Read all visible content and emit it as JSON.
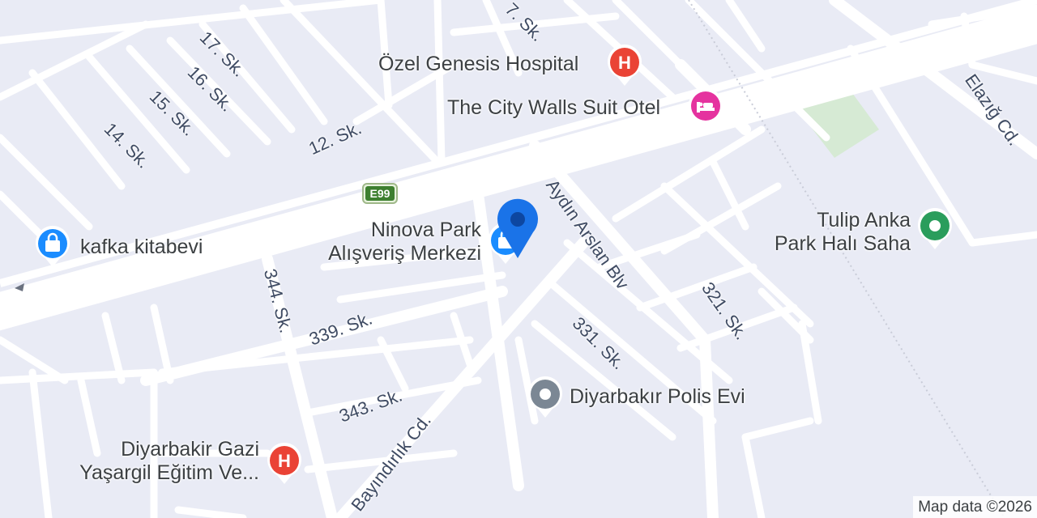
{
  "map": {
    "colors": {
      "background": "#e9ebf5",
      "road": "#ffffff",
      "park": "#d6ead4",
      "hospital": "#ea4335",
      "hotel": "#e5339f",
      "shopping": "#1a8cff",
      "park_poi": "#2a9d5c",
      "generic_poi": "#7b8794",
      "location_marker": "#1a73e8"
    },
    "streets": {
      "s17": "17. Sk.",
      "s16": "16. Sk.",
      "s15": "15. Sk.",
      "s14": "14. Sk.",
      "s12": "12. Sk.",
      "s7": "7. Sk.",
      "elazig": "Elazığ Cd.",
      "aydin": "Aydın Arslan Blv",
      "s321": "321. Sk.",
      "s331": "331. Sk.",
      "s339": "339. Sk.",
      "s344": "344. Sk.",
      "s343": "343. Sk.",
      "bayindirlik": "Bayındırlık Cd."
    },
    "route_shield": "E99",
    "pois": {
      "genesis": {
        "name": "Özel Genesis Hospital",
        "icon": "hospital-icon"
      },
      "city_walls": {
        "name": "The City Walls Suit Otel",
        "icon": "hotel-icon"
      },
      "ninova": {
        "name_line1": "Ninova Park",
        "name_line2": "Alışveriş Merkezi",
        "icon": "shopping-bag-icon"
      },
      "kafka": {
        "name": "kafka kitabevi",
        "icon": "shopping-bag-icon"
      },
      "tulip": {
        "name_line1": "Tulip Anka",
        "name_line2": "Park Halı Saha",
        "icon": "park-icon"
      },
      "polis": {
        "name": "Diyarbakır Polis Evi",
        "icon": "place-icon"
      },
      "gazi": {
        "name_line1": "Diyarbakir Gazi",
        "name_line2": "Yaşargil Eğitim Ve...",
        "icon": "hospital-icon"
      }
    },
    "attribution": "Map data ©2026"
  }
}
